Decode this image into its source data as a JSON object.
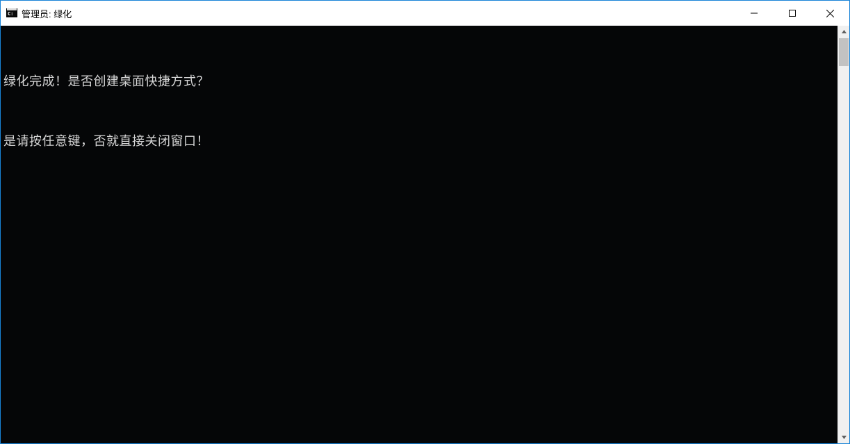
{
  "window": {
    "title": "管理员: 绿化"
  },
  "console": {
    "lines": [
      "绿化完成！是否创建桌面快捷方式？",
      "是请按任意键，否就直接关闭窗口！"
    ]
  }
}
